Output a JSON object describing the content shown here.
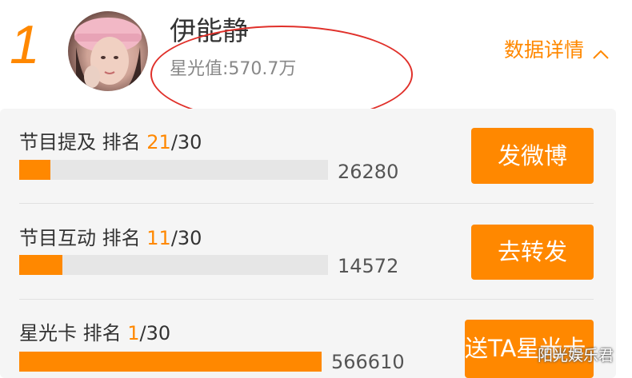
{
  "header": {
    "rank": "1",
    "name": "伊能静",
    "star_value": "星光值:570.7万",
    "details_label": "数据详情",
    "details_icon": "chevron-up-icon"
  },
  "colors": {
    "accent": "#ff8800",
    "highlight_ellipse": "#e0302a"
  },
  "rows": [
    {
      "label": "节目提及 排名 ",
      "rank_current": "21",
      "rank_total": "/30",
      "value": "26280",
      "progress_fraction": 0.1,
      "button_label": "发微博"
    },
    {
      "label": "节目互动 排名 ",
      "rank_current": "11",
      "rank_total": "/30",
      "value": "14572",
      "progress_fraction": 0.14,
      "button_label": "去转发"
    },
    {
      "label": "星光卡 排名 ",
      "rank_current": "1",
      "rank_total": "/30",
      "value": "566610",
      "progress_fraction": 1.0,
      "button_label": "送TA星光卡"
    }
  ],
  "watermark": "阳光娱乐君"
}
